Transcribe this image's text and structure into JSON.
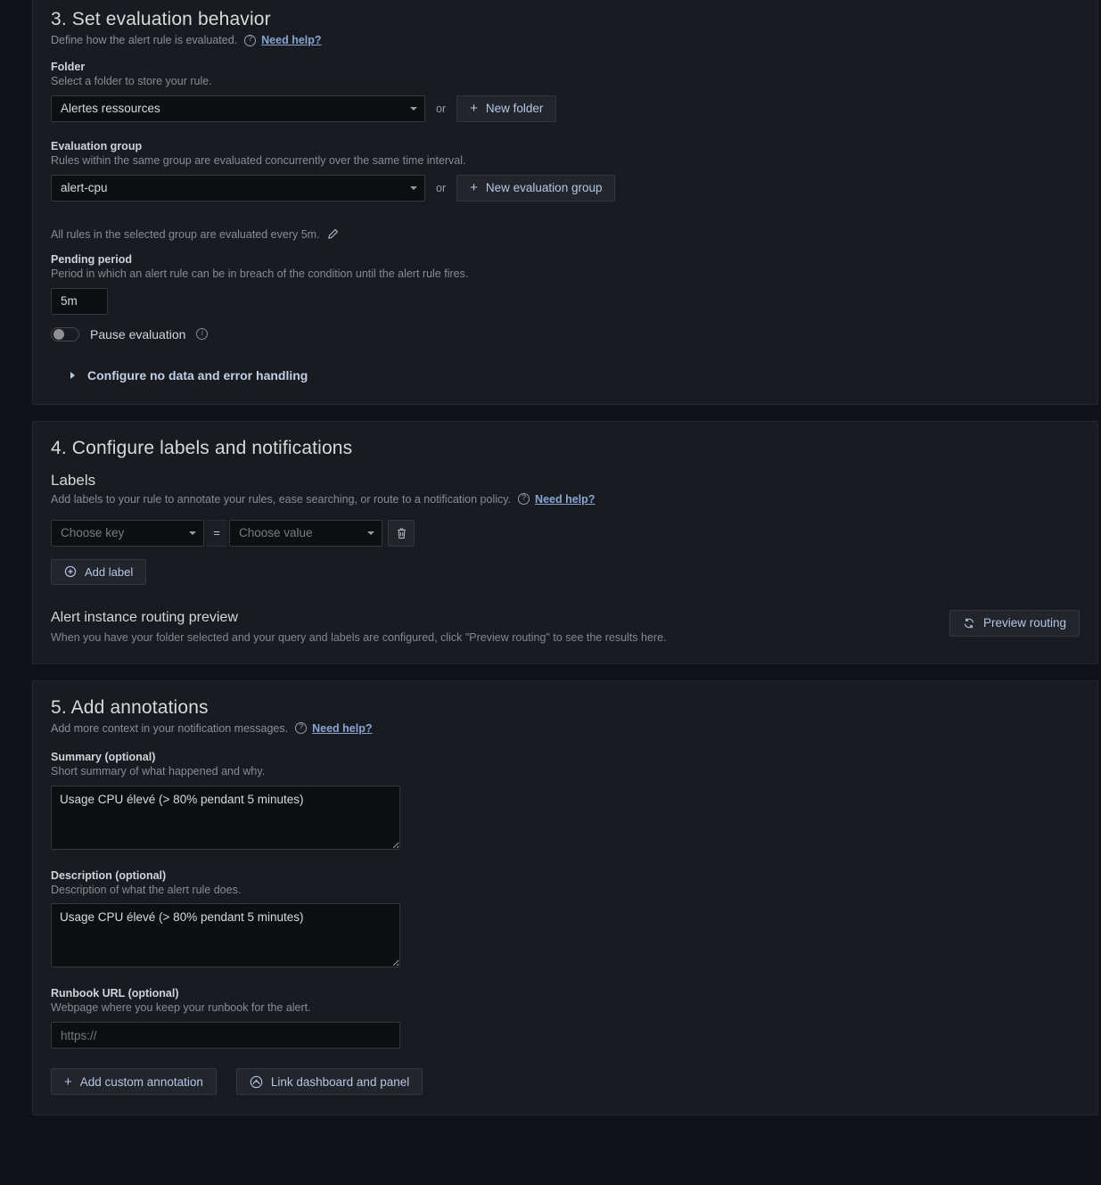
{
  "step3": {
    "title": "3. Set evaluation behavior",
    "subtitle": "Define how the alert rule is evaluated.",
    "need_help": "Need help?",
    "folder": {
      "label": "Folder",
      "desc": "Select a folder to store your rule.",
      "value": "Alertes ressources",
      "or": "or",
      "new_button": "New folder"
    },
    "evaluation_group": {
      "label": "Evaluation group",
      "desc": "Rules within the same group are evaluated concurrently over the same time interval.",
      "value": "alert-cpu",
      "or": "or",
      "new_button": "New evaluation group"
    },
    "eval_note": "All rules in the selected group are evaluated every 5m.",
    "pending_period": {
      "label": "Pending period",
      "desc": "Period in which an alert rule can be in breach of the condition until the alert rule fires.",
      "value": "5m"
    },
    "pause_evaluation": {
      "label": "Pause evaluation",
      "state": "off"
    },
    "collapse": "Configure no data and error handling"
  },
  "step4": {
    "title": "4. Configure labels and notifications",
    "labels": {
      "heading": "Labels",
      "desc": "Add labels to your rule to annotate your rules, ease searching, or route to a notification policy.",
      "need_help": "Need help?",
      "key_placeholder": "Choose key",
      "equals": "=",
      "value_placeholder": "Choose value",
      "add_label_button": "Add label"
    },
    "routing": {
      "heading": "Alert instance routing preview",
      "desc": "When you have your folder selected and your query and labels are configured, click \"Preview routing\" to see the results here.",
      "preview_button": "Preview routing"
    }
  },
  "step5": {
    "title": "5. Add annotations",
    "subtitle": "Add more context in your notification messages.",
    "need_help": "Need help?",
    "summary": {
      "label": "Summary (optional)",
      "desc": "Short summary of what happened and why.",
      "value": "Usage CPU élevé (> 80% pendant 5 minutes)"
    },
    "description": {
      "label": "Description (optional)",
      "desc": "Description of what the alert rule does.",
      "value": "Usage CPU élevé (> 80% pendant 5 minutes)"
    },
    "runbook": {
      "label": "Runbook URL (optional)",
      "desc": "Webpage where you keep your runbook for the alert.",
      "value": "",
      "placeholder": "https://"
    },
    "add_annotation_button": "Add custom annotation",
    "link_dashboard_button": "Link dashboard and panel"
  },
  "colors": {
    "page_bg": "#111217",
    "panel_bg": "#181b1f",
    "input_bg": "#0e0f12",
    "link": "#8aa4d6",
    "text": "#ccccdc",
    "muted": "#8b8b90"
  }
}
